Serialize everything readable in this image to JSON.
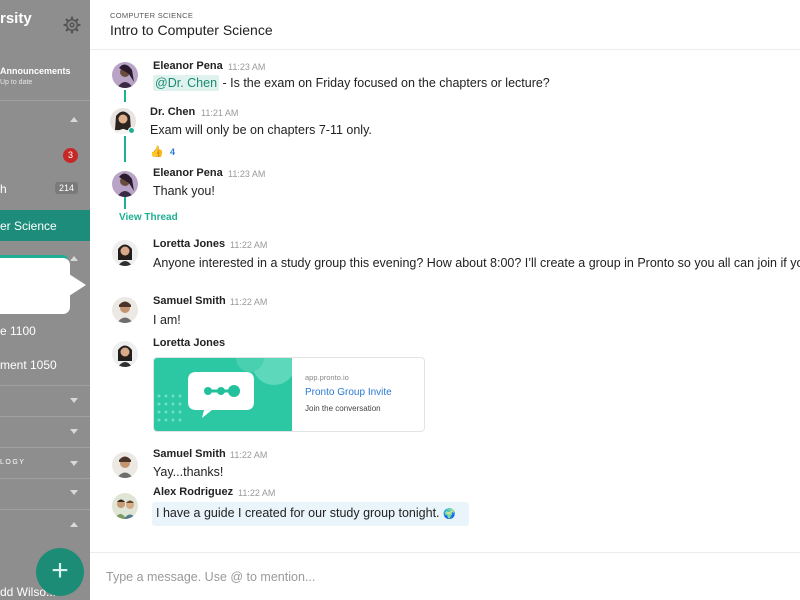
{
  "sidebar": {
    "brand_fragment": "rsity",
    "announcements_label": "Announcements",
    "announcements_sub": "Up to date",
    "unread_badge": "3",
    "item_count": "214",
    "item_h": "h",
    "active_channel": "er Science",
    "item_1100": "e 1100",
    "item_1050": "ment 1050",
    "section_label": "LOGY",
    "user_name": "dd Wilso...",
    "fab_label": "+"
  },
  "header": {
    "category": "COMPUTER SCIENCE",
    "title": "Intro to Computer Science"
  },
  "messages": [
    {
      "name": "Eleanor Pena",
      "time": "11:23 AM",
      "mention": "@Dr. Chen",
      "text": " - Is the exam on Friday focused on the chapters or lecture?"
    },
    {
      "name": "Dr. Chen",
      "time": "11:21 AM",
      "text": "Exam will only be on chapters 7-11 only.",
      "reaction": "👍",
      "reaction_count": "4"
    },
    {
      "name": "Eleanor Pena",
      "time": "11:23 AM",
      "text": "Thank you!"
    },
    {
      "name": "Loretta Jones",
      "time": "11:22 AM",
      "text": "Anyone interested in a study group this evening? How about 8:00? I’ll create a group in Pronto so you all can join if you are"
    },
    {
      "name": "Samuel Smith",
      "time": "11:22 AM",
      "text": "I am!"
    },
    {
      "name": "Loretta Jones",
      "time": ""
    },
    {
      "name": "Samuel Smith",
      "time": "11:22 AM",
      "text": "Yay...thanks!"
    },
    {
      "name": "Alex Rodriguez",
      "time": "11:22 AM",
      "text": "I have a guide I created for our study group tonight.",
      "icon": "🌍"
    }
  ],
  "view_thread_label": "View Thread",
  "link_card": {
    "url": "app.pronto.io",
    "title": "Pronto Group Invite",
    "subtitle": "Join the conversation"
  },
  "composer": {
    "placeholder": "Type a message. Use @ to mention..."
  },
  "colors": {
    "accent": "#1eaf94",
    "sidebar_bg": "#8e8e8e",
    "sidebar_active": "#1e8c7a",
    "link": "#2a7ad0",
    "badge": "#c62828"
  }
}
